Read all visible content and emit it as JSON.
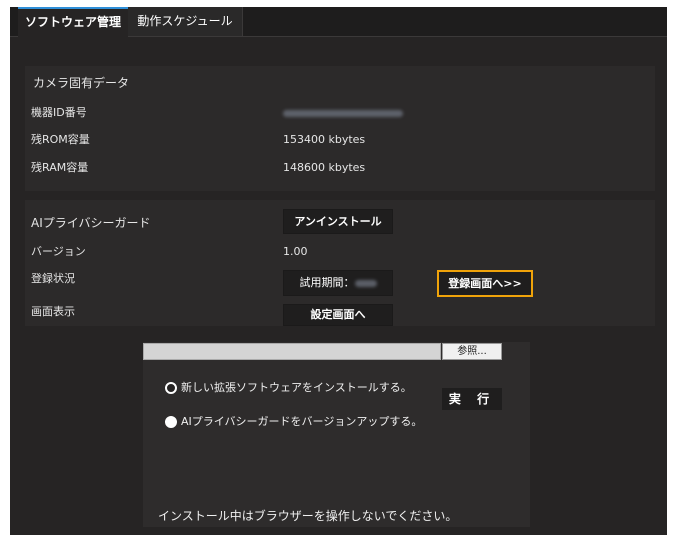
{
  "tabs": [
    {
      "label": "ソフトウェア管理",
      "active": true
    },
    {
      "label": "動作スケジュール",
      "active": false
    }
  ],
  "camera": {
    "section_title": "カメラ固有データ",
    "device_id_label": "機器ID番号",
    "rom_label": "残ROM容量",
    "rom_value": "153400 kbytes",
    "ram_label": "残RAM容量",
    "ram_value": "148600 kbytes"
  },
  "ai": {
    "section_title": "AIプライバシーガード",
    "uninstall_label": "アンインストール",
    "version_label": "バージョン",
    "version_value": "1.00",
    "status_label": "登録状況",
    "trial_label": "試用期間：",
    "register_button": "登録画面へ>>",
    "display_label": "画面表示",
    "settings_button": "設定画面へ"
  },
  "install": {
    "browse_label": "参照...",
    "option_new": "新しい拡張ソフトウェアをインストールする。",
    "option_upgrade": "AIプライバシーガードをバージョンアップする。",
    "execute_label": "実 行",
    "notice": "インストール中はブラウザーを操作しないでください。"
  },
  "colors": {
    "accent_tab": "#2f8fd8",
    "highlight_border": "#f0a30a",
    "panel_bg": "#262424"
  }
}
